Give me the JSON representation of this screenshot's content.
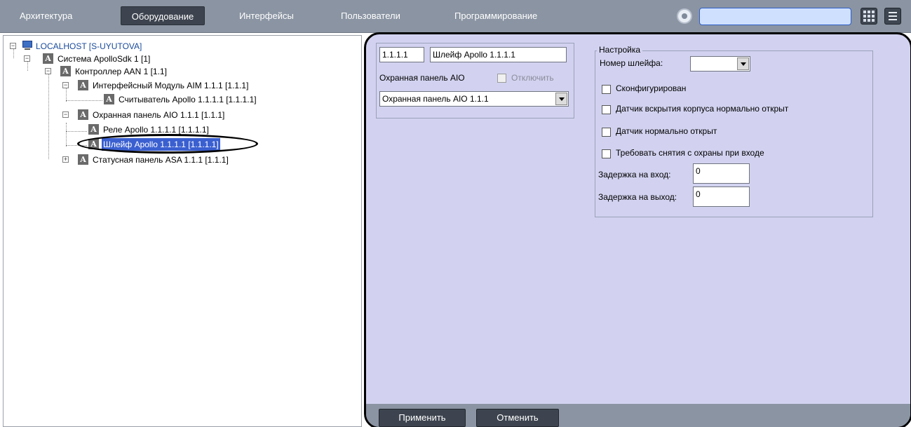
{
  "menu": {
    "tabs": [
      {
        "label": "Архитектура"
      },
      {
        "label": "Оборудование"
      },
      {
        "label": "Интерфейсы"
      },
      {
        "label": "Пользователи"
      },
      {
        "label": "Программирование"
      }
    ],
    "active_tab": "Оборудование",
    "search_value": ""
  },
  "tree": {
    "nodes": [
      {
        "label": "LOCALHOST [S-UYUTOVA]",
        "expander": "−"
      },
      {
        "label": "Система ApolloSdk 1 [1]",
        "expander": "−"
      },
      {
        "label": "Контроллер AAN 1 [1.1]",
        "expander": "−"
      },
      {
        "label": "Интерфейсный Модуль AIM 1.1.1 [1.1.1]",
        "expander": "−"
      },
      {
        "label": "Считыватель Apollo 1.1.1.1 [1.1.1.1]"
      },
      {
        "label": "Охранная панель AIO 1.1.1 [1.1.1]",
        "expander": "−"
      },
      {
        "label": "Реле Apollo 1.1.1.1 [1.1.1.1]"
      },
      {
        "label": "Шлейф Apollo 1.1.1.1 [1.1.1.1]"
      },
      {
        "label": "Статусная панель ASA 1.1.1 [1.1.1]",
        "expander": "+"
      }
    ],
    "selected": "Шлейф Apollo 1.1.1.1 [1.1.1.1]",
    "icon_letter": "A"
  },
  "object": {
    "id": "1.1.1.1",
    "name": "Шлейф Apollo 1.1.1.1",
    "parent_label": "Охранная панель AIO",
    "disable_label": "Отключить",
    "parent_value": "Охранная панель AIO 1.1.1"
  },
  "settings": {
    "group_title": "Настройка",
    "loop_number_label": "Номер шлейфа:",
    "loop_number_value": "",
    "checkboxes": [
      {
        "label": "Сконфигурирован",
        "checked": false
      },
      {
        "label": "Датчик вскрытия корпуса нормально открыт",
        "checked": false
      },
      {
        "label": "Датчик нормально открыт",
        "checked": false
      },
      {
        "label": "Требовать снятия с охраны при входе",
        "checked": false
      }
    ],
    "entry_delay_label": "Задержка на вход:",
    "entry_delay_value": "0",
    "exit_delay_label": "Задержка на выход:",
    "exit_delay_value": "0"
  },
  "footer": {
    "apply_label": "Применить",
    "cancel_label": "Отменить"
  },
  "colors": {
    "topbar": "#8a94a2",
    "active_tab": "#3d444f",
    "panel_bg": "#d2d2f0",
    "selection": "#3a5fd0"
  }
}
